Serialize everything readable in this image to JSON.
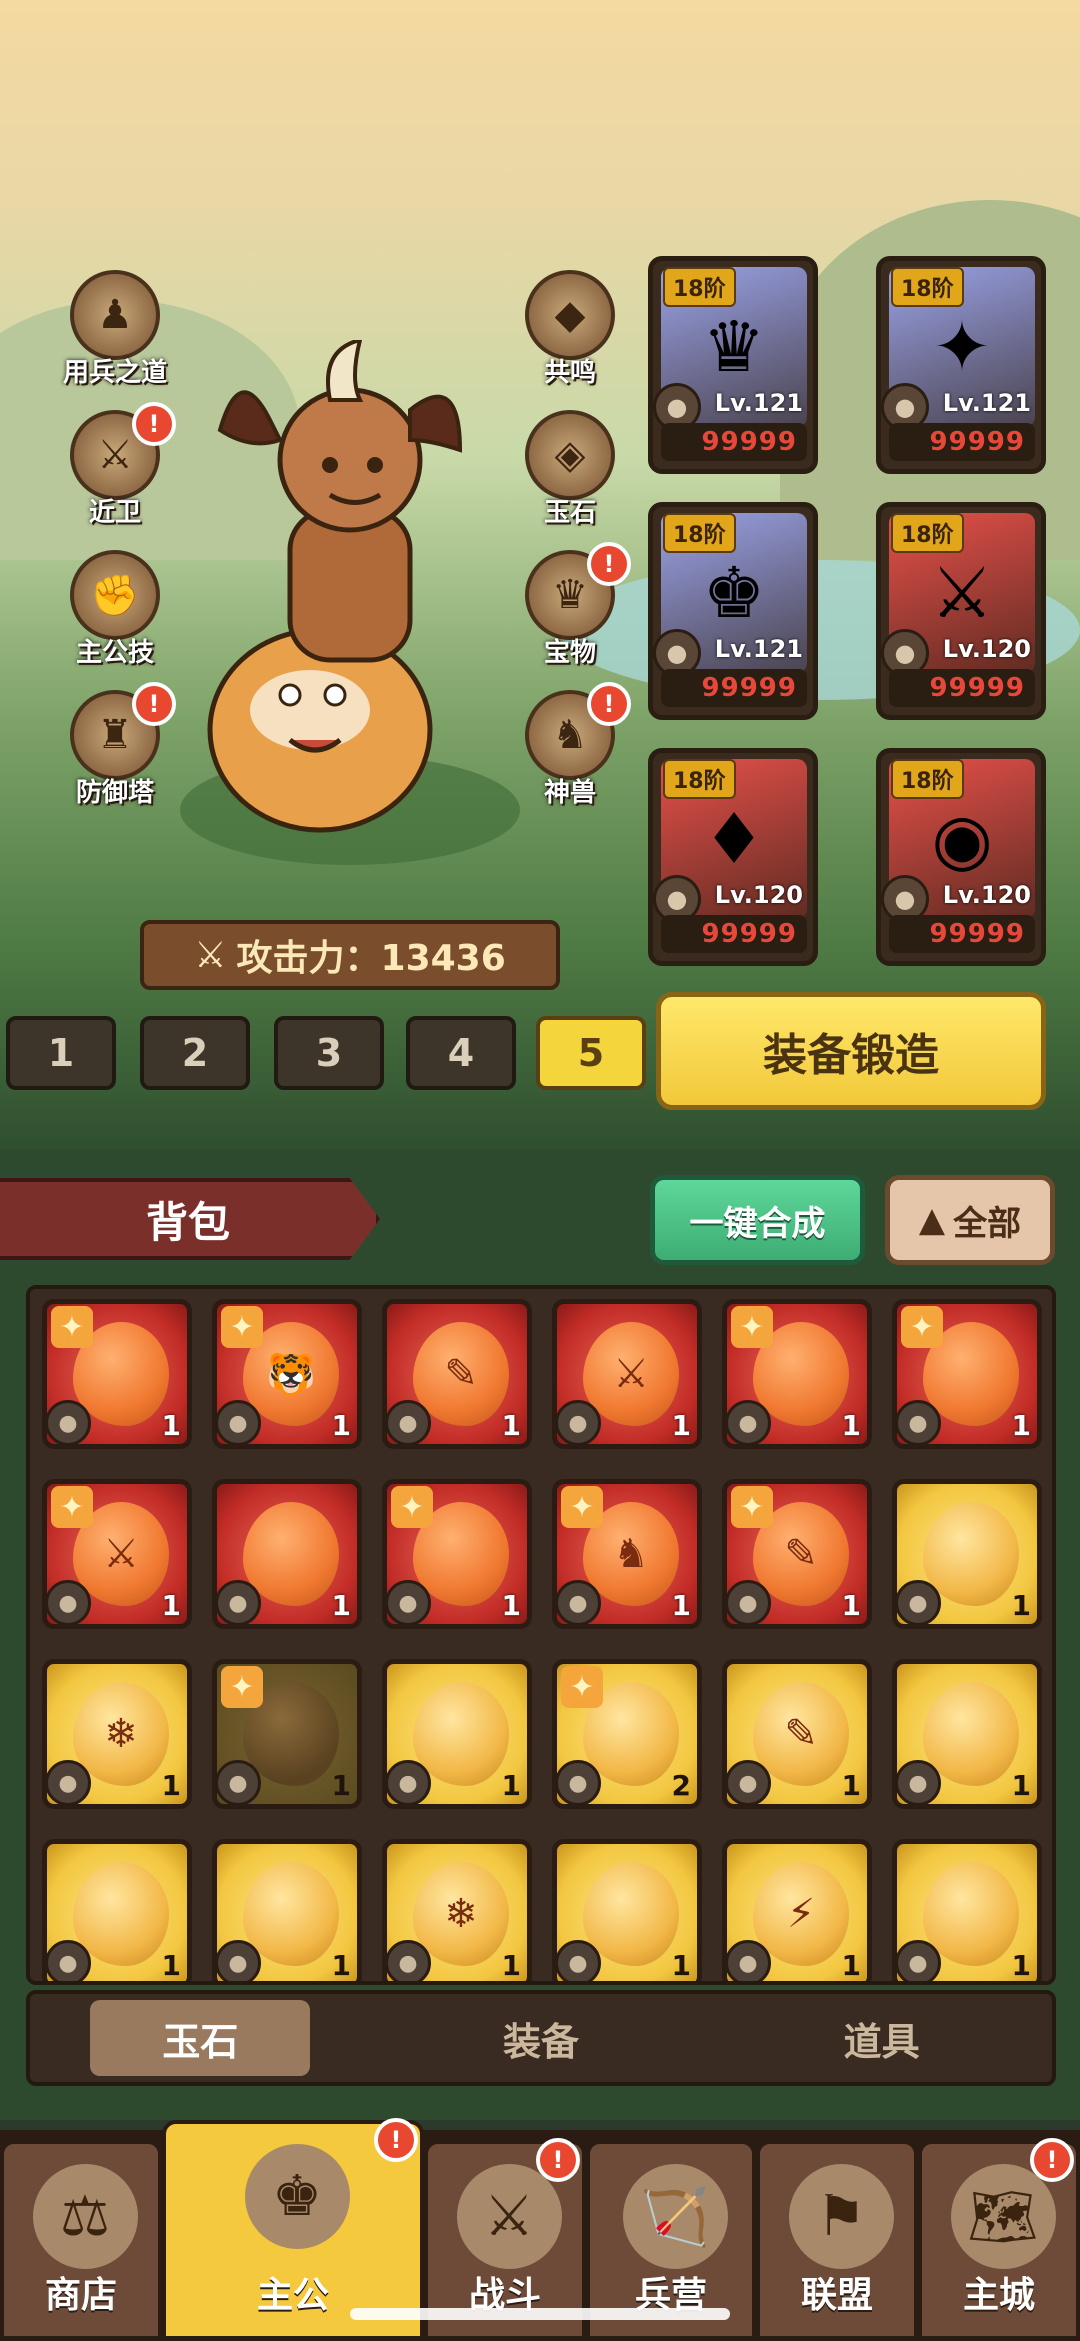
{
  "left_menu": [
    {
      "label": "用兵之道",
      "icon": "strategy-icon",
      "glyph": "♟",
      "badge": false
    },
    {
      "label": "近卫",
      "icon": "guard-icon",
      "glyph": "⚔",
      "badge": true
    },
    {
      "label": "主公技",
      "icon": "skill-icon",
      "glyph": "✊",
      "badge": false
    },
    {
      "label": "防御塔",
      "icon": "tower-icon",
      "glyph": "♜",
      "badge": true
    }
  ],
  "right_menu": [
    {
      "label": "共鸣",
      "icon": "resonance-icon",
      "glyph": "◆",
      "badge": false
    },
    {
      "label": "玉石",
      "icon": "jade-icon",
      "glyph": "◈",
      "badge": false
    },
    {
      "label": "宝物",
      "icon": "treasure-icon",
      "glyph": "♛",
      "badge": true
    },
    {
      "label": "神兽",
      "icon": "beast-icon",
      "glyph": "♞",
      "badge": true
    }
  ],
  "badge_mark": "!",
  "attack": {
    "label": "攻击力：13436",
    "icon": "crossed-swords-icon"
  },
  "equipment": [
    {
      "tier": "18阶",
      "level": "Lv.121",
      "value": "99999",
      "slot_icon": "helmet",
      "glyph": "♛",
      "bg": "#9aa2e6"
    },
    {
      "tier": "18阶",
      "level": "Lv.121",
      "value": "99999",
      "slot_icon": "armor",
      "glyph": "✦",
      "bg": "#9aa2e6"
    },
    {
      "tier": "18阶",
      "level": "Lv.121",
      "value": "99999",
      "slot_icon": "boots",
      "glyph": "♚",
      "bg": "#9aa2e6"
    },
    {
      "tier": "18阶",
      "level": "Lv.120",
      "value": "99999",
      "slot_icon": "weapon",
      "glyph": "⚔",
      "bg": "#e6504a"
    },
    {
      "tier": "18阶",
      "level": "Lv.120",
      "value": "99999",
      "slot_icon": "ring",
      "glyph": "♦",
      "bg": "#e6504a"
    },
    {
      "tier": "18阶",
      "level": "Lv.120",
      "value": "99999",
      "slot_icon": "amulet",
      "glyph": "◉",
      "bg": "#e6504a"
    }
  ],
  "loadouts": [
    "1",
    "2",
    "3",
    "4",
    "5"
  ],
  "active_loadout": "5",
  "forge_label": "装备锻造",
  "bag": {
    "title": "背包",
    "merge_label": "一键合成",
    "filter_label": "全部"
  },
  "items": [
    {
      "rarity": "red",
      "star": true,
      "glyph": "",
      "count": "1"
    },
    {
      "rarity": "red",
      "star": true,
      "glyph": "🐯",
      "count": "1"
    },
    {
      "rarity": "red",
      "star": false,
      "glyph": "✎",
      "count": "1"
    },
    {
      "rarity": "red",
      "star": false,
      "glyph": "⚔",
      "count": "1"
    },
    {
      "rarity": "red",
      "star": true,
      "glyph": "",
      "count": "1"
    },
    {
      "rarity": "red",
      "star": true,
      "glyph": "",
      "count": "1"
    },
    {
      "rarity": "red",
      "star": true,
      "glyph": "⚔",
      "count": "1"
    },
    {
      "rarity": "red",
      "star": false,
      "glyph": "",
      "count": "1"
    },
    {
      "rarity": "red",
      "star": true,
      "glyph": "",
      "count": "1"
    },
    {
      "rarity": "red",
      "star": true,
      "glyph": "♞",
      "count": "1"
    },
    {
      "rarity": "red",
      "star": true,
      "glyph": "✎",
      "count": "1"
    },
    {
      "rarity": "gold",
      "star": false,
      "glyph": "",
      "count": "1"
    },
    {
      "rarity": "gold",
      "star": false,
      "glyph": "❄",
      "count": "1"
    },
    {
      "rarity": "dim",
      "star": true,
      "glyph": "",
      "count": "1"
    },
    {
      "rarity": "gold",
      "star": false,
      "glyph": "",
      "count": "1"
    },
    {
      "rarity": "gold",
      "star": true,
      "glyph": "",
      "count": "2"
    },
    {
      "rarity": "gold",
      "star": false,
      "glyph": "✎",
      "count": "1"
    },
    {
      "rarity": "gold",
      "star": false,
      "glyph": "",
      "count": "1"
    },
    {
      "rarity": "gold",
      "star": false,
      "glyph": "",
      "count": "1"
    },
    {
      "rarity": "gold",
      "star": false,
      "glyph": "",
      "count": "1"
    },
    {
      "rarity": "gold",
      "star": false,
      "glyph": "❄",
      "count": "1"
    },
    {
      "rarity": "gold",
      "star": false,
      "glyph": "",
      "count": "1"
    },
    {
      "rarity": "gold",
      "star": false,
      "glyph": "⚡",
      "count": "1"
    },
    {
      "rarity": "gold",
      "star": false,
      "glyph": "",
      "count": "1"
    }
  ],
  "bag_tabs": [
    "玉石",
    "装备",
    "道具"
  ],
  "active_bag_tab": "玉石",
  "bottom_nav": [
    {
      "label": "商店",
      "icon": "shop-icon",
      "glyph": "⚖",
      "badge": false
    },
    {
      "label": "主公",
      "icon": "lord-icon",
      "glyph": "♚",
      "badge": true
    },
    {
      "label": "战斗",
      "icon": "battle-icon",
      "glyph": "⚔",
      "badge": true
    },
    {
      "label": "兵营",
      "icon": "barracks-icon",
      "glyph": "🏹",
      "badge": false
    },
    {
      "label": "联盟",
      "icon": "alliance-icon",
      "glyph": "⚑",
      "badge": false
    },
    {
      "label": "主城",
      "icon": "city-icon",
      "glyph": "🗺",
      "badge": true
    }
  ],
  "active_nav": "主公"
}
